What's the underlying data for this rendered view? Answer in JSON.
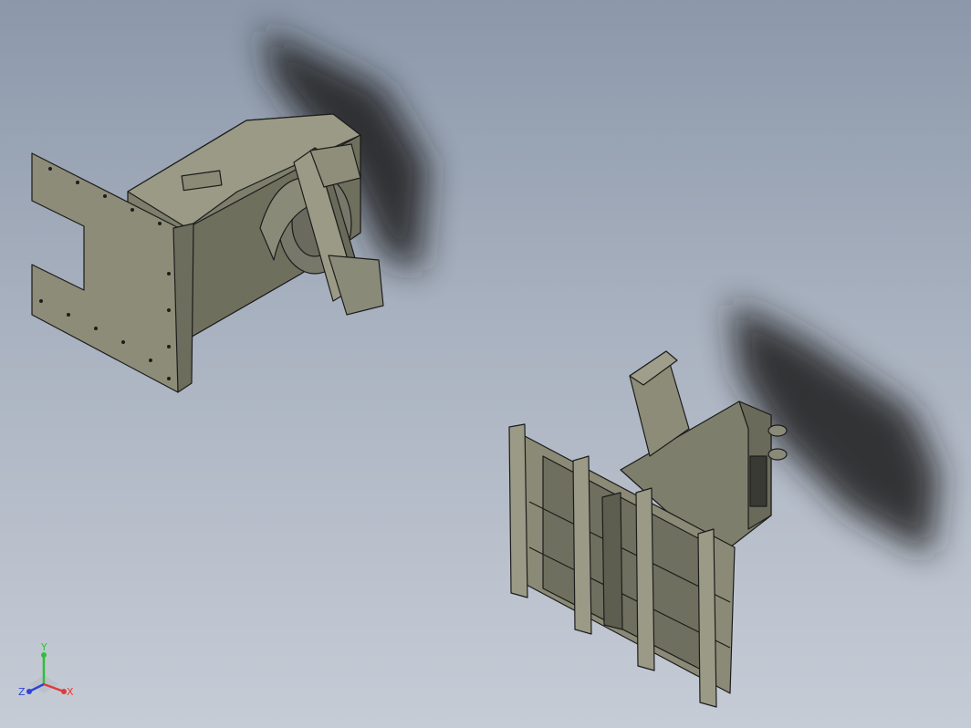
{
  "viewport": {
    "background_top": "#8c98aa",
    "background_bottom": "#c6ccd6"
  },
  "model": {
    "part_color": "#8a8a78",
    "edge_color": "#1c1c1c",
    "shadow_color": "#1a1a1a"
  },
  "triad": {
    "x_label": "X",
    "y_label": "Y",
    "z_label": "Z",
    "x_color": "#e23a3a",
    "y_color": "#2fbf3a",
    "z_color": "#2c44d8"
  }
}
